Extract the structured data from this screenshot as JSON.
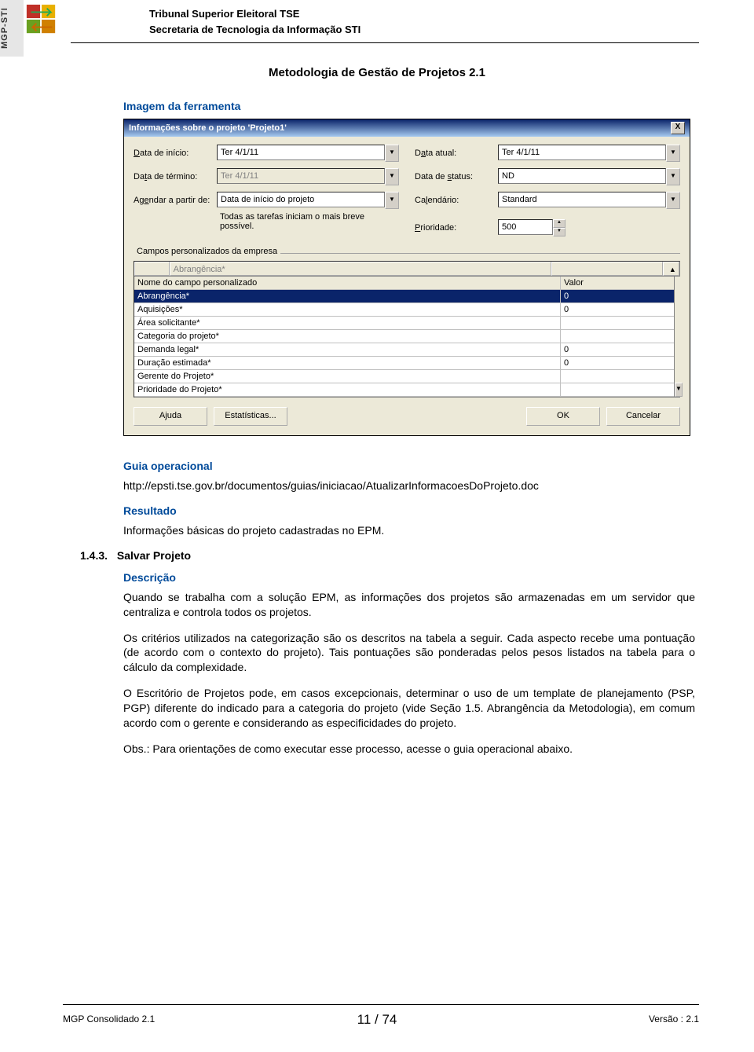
{
  "sidebar_label": "MGP-STI",
  "header": {
    "line1": "Tribunal Superior Eleitoral   TSE",
    "line2": "Secretaria de Tecnologia da Informação   STI"
  },
  "doc_title": "Metodologia de Gestão de Projetos 2.1",
  "sec_imagem": "Imagem da ferramenta",
  "dialog": {
    "title": "Informações sobre o projeto 'Projeto1'",
    "close": "X",
    "lbl_data_inicio": "Data de início:",
    "val_data_inicio": "Ter 4/1/11",
    "lbl_data_atual": "Data atual:",
    "val_data_atual": "Ter 4/1/11",
    "lbl_data_termino": "Data de término:",
    "val_data_termino": "Ter 4/1/11",
    "lbl_data_status": "Data de status:",
    "val_data_status": "ND",
    "lbl_agendar": "Agendar a partir de:",
    "val_agendar": "Data de início do projeto",
    "lbl_calendario": "Calendário:",
    "val_calendario": "Standard",
    "note": "Todas as tarefas iniciam o mais breve possível.",
    "lbl_prioridade": "Prioridade:",
    "val_prioridade": "500",
    "fieldset": "Campos personalizados da empresa",
    "grid_head0": "",
    "grid_head1": "Abrangência*",
    "grid_head2": "",
    "row_head_name": "Nome do campo personalizado",
    "row_head_val": "Valor",
    "rows": [
      {
        "n": "Abrangência*",
        "v": "0"
      },
      {
        "n": "Aquisições*",
        "v": "0"
      },
      {
        "n": "Área solicitante*",
        "v": ""
      },
      {
        "n": "Categoria do projeto*",
        "v": ""
      },
      {
        "n": "Demanda legal*",
        "v": "0"
      },
      {
        "n": "Duração estimada*",
        "v": "0"
      },
      {
        "n": "Gerente do Projeto*",
        "v": ""
      },
      {
        "n": "Prioridade do Projeto*",
        "v": ""
      }
    ],
    "btn_ajuda": "Ajuda",
    "btn_estat": "Estatísticas...",
    "btn_ok": "OK",
    "btn_cancel": "Cancelar"
  },
  "sec_guia": "Guia operacional",
  "link_guia": "http://epsti.tse.gov.br/documentos/guias/iniciacao/AtualizarInformacoesDoProjeto.doc",
  "sec_resultado": "Resultado",
  "resultado_text": "Informações básicas do projeto cadastradas no EPM.",
  "sec143_num": "1.4.3.",
  "sec143_title": "Salvar Projeto",
  "sec_descricao": "Descrição",
  "p1": "Quando se trabalha com a solução EPM, as informações dos projetos são armazenadas em um servidor que centraliza e controla todos os projetos.",
  "p2": "Os critérios utilizados na categorização são os descritos na tabela a seguir. Cada aspecto recebe uma pontuação (de acordo com o contexto do projeto). Tais pontuações são ponderadas pelos pesos listados na tabela para o cálculo da complexidade.",
  "p3": "O Escritório de Projetos pode, em casos excepcionais, determinar o uso de um template de planejamento (PSP, PGP) diferente do indicado para a categoria do projeto (vide Seção 1.5. Abrangência da Metodologia), em comum acordo com o gerente e considerando as especificidades do projeto.",
  "p4": "Obs.: Para orientações de como executar esse processo, acesse o guia operacional abaixo.",
  "footer": {
    "left": "MGP Consolidado 2.1",
    "center": "11 / 74",
    "right": "Versão :  2.1"
  }
}
